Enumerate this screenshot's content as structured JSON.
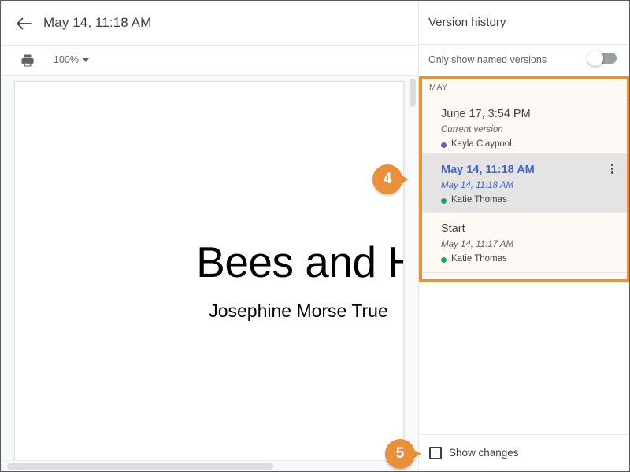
{
  "document_pane": {
    "back_icon": "back-arrow-icon",
    "title": "May 14, 11:18 AM",
    "toolbar": {
      "print_icon": "print-icon",
      "zoom_level": "100%",
      "zoom_caret": "chevron-down-icon"
    },
    "page": {
      "title": "Bees and Honey",
      "subtitle": "Josephine Morse True"
    }
  },
  "version_history": {
    "title": "Version history",
    "named_versions_label": "Only show named versions",
    "named_versions_toggle": "off",
    "month_label": "MAY",
    "items": [
      {
        "name": "June 17, 3:54 PM",
        "subtitle": "Current version",
        "author": "Kayla Claypool",
        "author_color": "#5b5bc0",
        "selected": false
      },
      {
        "name": "May 14, 11:18 AM",
        "subtitle": "May 14, 11:18 AM",
        "author": "Katie Thomas",
        "author_color": "#1aa260",
        "selected": true,
        "menu_icon": "more-vertical-icon"
      },
      {
        "name": "Start",
        "subtitle": "May 14, 11:17 AM",
        "author": "Katie Thomas",
        "author_color": "#1aa260",
        "selected": false
      }
    ],
    "footer": {
      "show_changes_label": "Show changes",
      "show_changes_checked": "unchecked"
    }
  },
  "callouts": [
    {
      "number": "4"
    },
    {
      "number": "5"
    }
  ],
  "colors": {
    "highlight": "#e8903a",
    "selected_row": "#e6e8f0",
    "selected_text": "#3367d6"
  }
}
